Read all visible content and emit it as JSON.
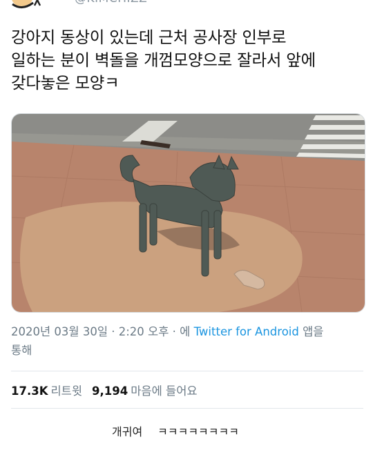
{
  "header": {
    "handle": "@KIMCHIZZ"
  },
  "tweet": {
    "lines": [
      "강아지 동상이 있는데 근처 공사장 인부로",
      "일하는 분이 벽돌을 개껌모양으로 잘라서 앞에",
      "갖다놓은 모양ㅋ"
    ]
  },
  "meta": {
    "datetime": "2020년 03월 30일 · 2:20 오후 · 에 ",
    "source": "Twitter for Android",
    "suffix": " 앱을",
    "line2": "통해"
  },
  "stats": {
    "retweets": "17.3K",
    "retweets_label": "리트윗",
    "likes": "9,194",
    "likes_label": "마음에 들어요"
  },
  "comment": {
    "text": "개귀여",
    "laugh": "ㅋㅋㅋㅋㅋㅋㅋㅋ"
  },
  "colors": {
    "link": "#1b95e0",
    "muted": "#6b7a86",
    "divider": "#e1e6ea"
  }
}
